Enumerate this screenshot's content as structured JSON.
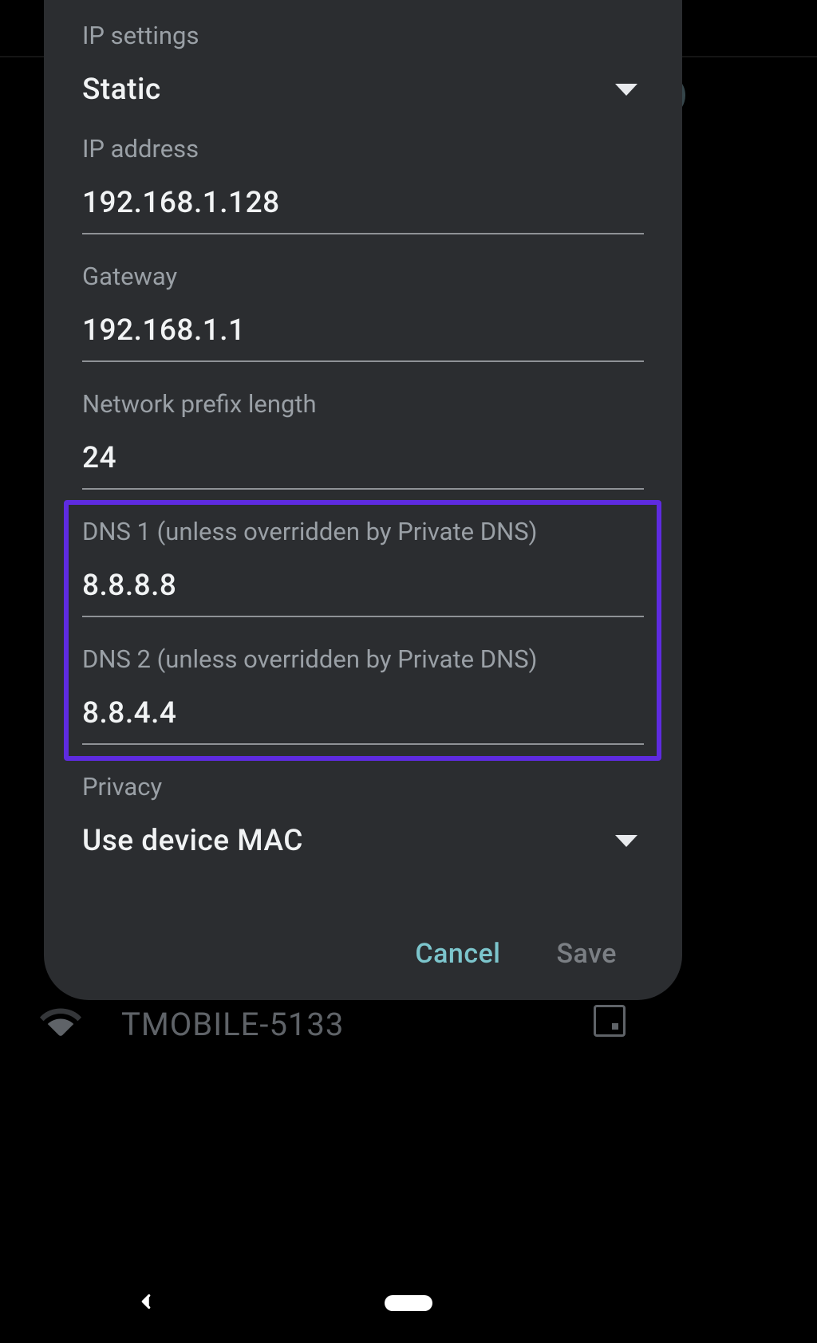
{
  "fields": {
    "ip_settings": {
      "label": "IP settings",
      "value": "Static"
    },
    "ip_address": {
      "label": "IP address",
      "value": "192.168.1.128"
    },
    "gateway": {
      "label": "Gateway",
      "value": "192.168.1.1"
    },
    "prefix": {
      "label": "Network prefix length",
      "value": "24"
    },
    "dns1": {
      "label": "DNS 1 (unless overridden by Private DNS)",
      "value": "8.8.8.8"
    },
    "dns2": {
      "label": "DNS 2 (unless overridden by Private DNS)",
      "value": "8.8.4.4"
    },
    "privacy": {
      "label": "Privacy",
      "value": "Use device MAC"
    }
  },
  "actions": {
    "cancel": "Cancel",
    "save": "Save"
  },
  "background": {
    "wifi_name": "TMOBILE-5133"
  }
}
